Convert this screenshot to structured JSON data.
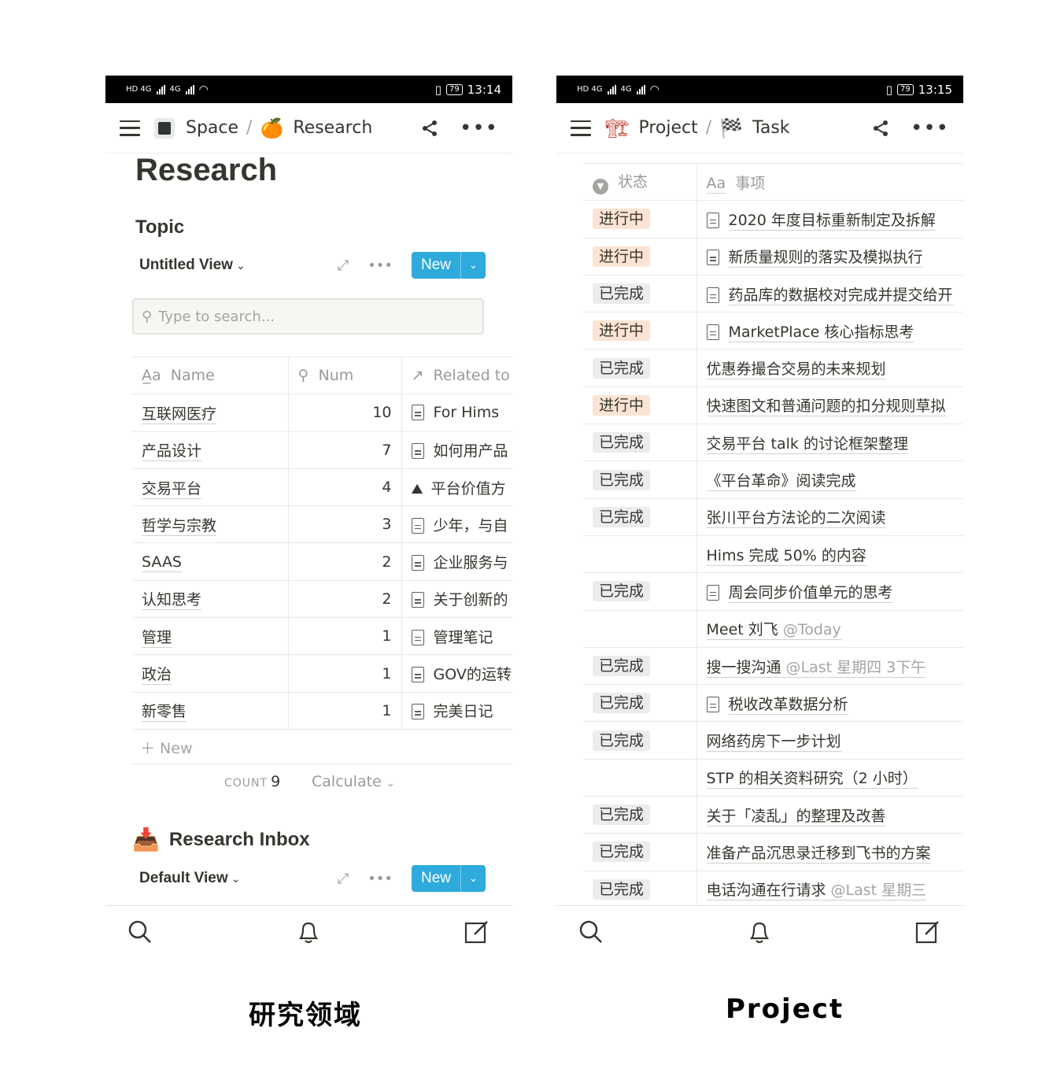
{
  "left": {
    "status": {
      "time": "13:14",
      "battery": "79"
    },
    "breadcrumb": {
      "space": "Space",
      "page": "Research"
    },
    "title": "Research",
    "section1": "Topic",
    "view1": "Untitled View",
    "new_label": "New",
    "search_placeholder": "Type to search...",
    "columns": {
      "name": "Name",
      "num": "Num",
      "related": "Related to"
    },
    "rows": [
      {
        "name": "互联网医疗",
        "num": "10",
        "rel": "For Hims"
      },
      {
        "name": "产品设计",
        "num": "7",
        "rel": "如何用产品"
      },
      {
        "name": "交易平台",
        "num": "4",
        "rel": "平台价值方"
      },
      {
        "name": "哲学与宗教",
        "num": "3",
        "rel": "少年，与自"
      },
      {
        "name": "SAAS",
        "num": "2",
        "rel": "企业服务与"
      },
      {
        "name": "认知思考",
        "num": "2",
        "rel": "关于创新的"
      },
      {
        "name": "管理",
        "num": "1",
        "rel": "管理笔记"
      },
      {
        "name": "政治",
        "num": "1",
        "rel": "GOV的运转"
      },
      {
        "name": "新零售",
        "num": "1",
        "rel": "完美日记"
      }
    ],
    "new_row": "New",
    "count_label": "COUNT",
    "count_value": "9",
    "calculate": "Calculate",
    "section2": "Research Inbox",
    "view2": "Default View"
  },
  "right": {
    "status": {
      "time": "13:15",
      "battery": "79"
    },
    "breadcrumb": {
      "space": "Project",
      "page": "Task"
    },
    "columns": {
      "status": "状态",
      "item": "事项"
    },
    "rows": [
      {
        "status": "进行中",
        "kind": "ing",
        "doc": true,
        "text": "2020 年度目标重新制定及拆解",
        "mention": ""
      },
      {
        "status": "进行中",
        "kind": "ing",
        "doc": true,
        "text": "新质量规则的落实及模拟执行",
        "mention": ""
      },
      {
        "status": "已完成",
        "kind": "done",
        "doc": true,
        "text": "药品库的数据校对完成并提交给开",
        "mention": ""
      },
      {
        "status": "进行中",
        "kind": "ing",
        "doc": true,
        "text": "MarketPlace 核心指标思考",
        "mention": ""
      },
      {
        "status": "已完成",
        "kind": "done",
        "doc": false,
        "text": "优惠券撮合交易的未来规划",
        "mention": ""
      },
      {
        "status": "进行中",
        "kind": "ing",
        "doc": false,
        "text": "快速图文和普通问题的扣分规则草拟",
        "mention": ""
      },
      {
        "status": "已完成",
        "kind": "done",
        "doc": false,
        "text": "交易平台 talk 的讨论框架整理",
        "mention": ""
      },
      {
        "status": "已完成",
        "kind": "done",
        "doc": false,
        "text": "《平台革命》阅读完成",
        "mention": ""
      },
      {
        "status": "已完成",
        "kind": "done",
        "doc": false,
        "text": "张川平台方法论的二次阅读",
        "mention": ""
      },
      {
        "status": "",
        "kind": "",
        "doc": false,
        "text": "Hims 完成 50% 的内容",
        "mention": ""
      },
      {
        "status": "已完成",
        "kind": "done",
        "doc": true,
        "text": "周会同步价值单元的思考",
        "mention": ""
      },
      {
        "status": "",
        "kind": "",
        "doc": false,
        "text": "Meet 刘飞 ",
        "mention": "@Today"
      },
      {
        "status": "已完成",
        "kind": "done",
        "doc": false,
        "text": "搜一搜沟通 ",
        "mention": "@Last 星期四 3下午"
      },
      {
        "status": "已完成",
        "kind": "done",
        "doc": true,
        "text": "税收改革数据分析",
        "mention": ""
      },
      {
        "status": "已完成",
        "kind": "done",
        "doc": false,
        "text": "网络药房下一步计划",
        "mention": ""
      },
      {
        "status": "",
        "kind": "",
        "doc": false,
        "text": "STP 的相关资料研究（2 小时）",
        "mention": ""
      },
      {
        "status": "已完成",
        "kind": "done",
        "doc": false,
        "text": "关于「凌乱」的整理及改善",
        "mention": ""
      },
      {
        "status": "已完成",
        "kind": "done",
        "doc": false,
        "text": "准备产品沉思录迁移到飞书的方案",
        "mention": ""
      },
      {
        "status": "已完成",
        "kind": "done",
        "doc": false,
        "text": "电话沟通在行请求 ",
        "mention": "@Last 星期三"
      }
    ]
  },
  "captions": {
    "left": "研究领域",
    "right": "Project"
  }
}
